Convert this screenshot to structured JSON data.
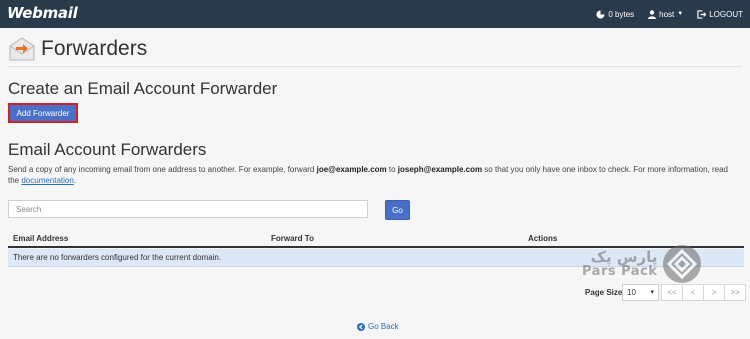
{
  "app": {
    "brand": "Webmail"
  },
  "topbar": {
    "disk_usage": "0 bytes",
    "user": "host",
    "logout": "LOGOUT"
  },
  "header": {
    "title": "Forwarders"
  },
  "create_section": {
    "heading": "Create an Email Account Forwarder",
    "add_button": "Add Forwarder"
  },
  "list_section": {
    "heading": "Email Account Forwarders",
    "desc_part1": "Send a copy of any incoming email from one address to another. For example, forward ",
    "desc_email1": "joe@example.com",
    "desc_part2": " to ",
    "desc_email2": "joseph@example.com",
    "desc_part3": " so that you only have one inbox to check. For more information, read the ",
    "desc_link": "documentation",
    "desc_part4": "."
  },
  "search": {
    "placeholder": "Search",
    "go_label": "Go"
  },
  "table": {
    "columns": [
      "Email Address",
      "Forward To",
      "Actions"
    ],
    "empty_message": "There are no forwarders configured for the current domain."
  },
  "watermark": {
    "fa": "پارس پک",
    "en": "Pars Pack"
  },
  "pagination": {
    "page_size_label": "Page Size",
    "page_size_value": "10",
    "buttons": [
      "<<",
      "<",
      ">",
      ">>"
    ]
  },
  "footer": {
    "go_back": "Go Back"
  },
  "colors": {
    "topbar": "#293a4a",
    "primary_button": "#4a6fc6",
    "highlight_border": "#d0202a",
    "empty_row": "#dce8f5",
    "link": "#2a6ebb"
  },
  "icons": {
    "header": "envelope-forward-icon",
    "disk": "pie-chart-icon",
    "user": "user-icon",
    "logout": "logout-icon",
    "back": "circle-arrow-left-icon"
  }
}
